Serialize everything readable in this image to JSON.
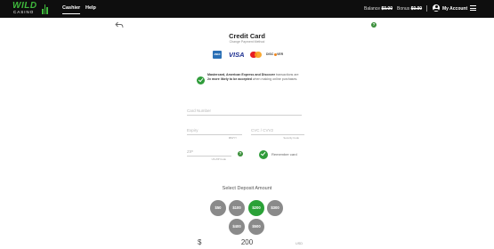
{
  "header": {
    "logo_text": "WILD",
    "logo_sub": "CASINO",
    "nav": [
      "Cashier",
      "Help"
    ],
    "balance_label": "Balance",
    "balance_value": "$0.00",
    "bonus_label": "Bonus",
    "bonus_value": "$0.00",
    "account_label": "My Account"
  },
  "page": {
    "title": "Credit Card",
    "subtitle": "Change Payment Method",
    "help_glyph": "?"
  },
  "cards": [
    "AMEX",
    "VISA",
    "Mastercard",
    "DISCOVER"
  ],
  "notice": {
    "bold_1": "Mastercard, American Express and Discover",
    "text_1": " transactions are ",
    "bold_2": "2x more likely to be accepted",
    "text_2": " when making online purchases."
  },
  "form": {
    "card_number_placeholder": "Card Number",
    "expiry_placeholder": "Expiry",
    "expiry_hint": "MM/YY",
    "cvc_placeholder": "CVC / CVV2",
    "cvc_hint": "Security Code",
    "zip_placeholder": "ZIP",
    "zip_hint": "US ZIP Code",
    "remember_label": "Remember card"
  },
  "deposit": {
    "label": "Select Deposit Amount",
    "amounts": [
      "$50",
      "$100",
      "$200",
      "$300",
      "$400",
      "$500"
    ],
    "selected": "$200",
    "currency_symbol": "$",
    "amount_value": "200",
    "currency_code": "USD"
  },
  "colors": {
    "accent_green": "#2aa137",
    "topbar": "#0e0e0e",
    "chip_gray": "#8a8a8a"
  }
}
